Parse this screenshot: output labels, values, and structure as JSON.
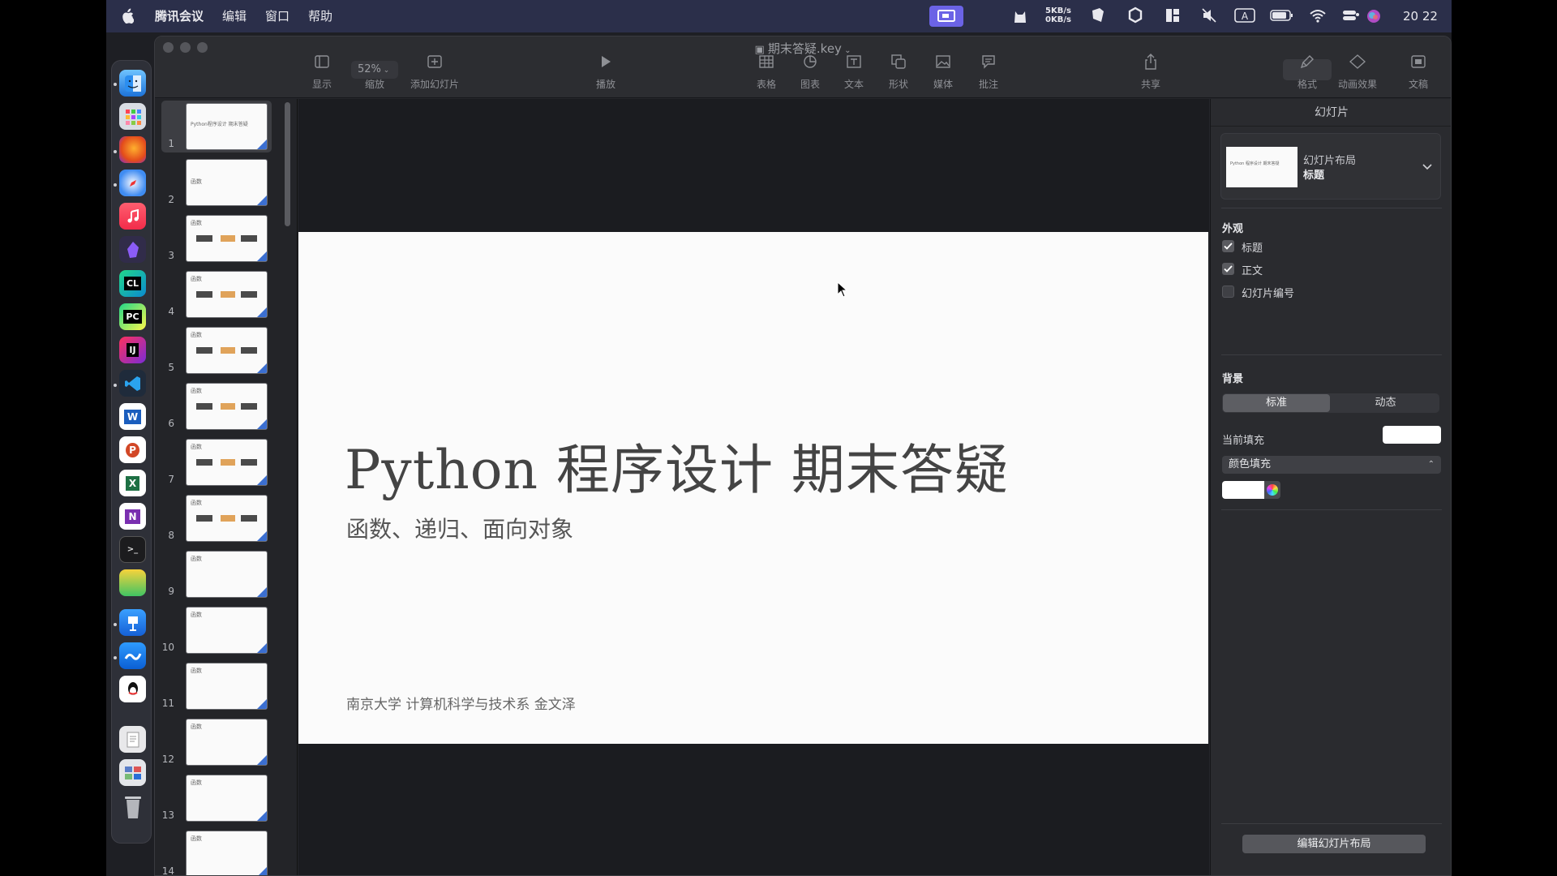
{
  "menubar": {
    "items": [
      "腾讯会议",
      "编辑",
      "窗口",
      "帮助"
    ],
    "net_up": "5KB/s",
    "net_down": "0KB/s",
    "time": "20 22"
  },
  "window": {
    "title": "期末答疑.key"
  },
  "toolbar": {
    "view": "显示",
    "zoom_value": "52%",
    "zoom": "缩放",
    "add_slide": "添加幻灯片",
    "play": "播放",
    "table": "表格",
    "chart": "图表",
    "text": "文本",
    "shape": "形状",
    "media": "媒体",
    "comment": "批注",
    "share": "共享",
    "format": "格式",
    "animate": "动画效果",
    "document": "文稿"
  },
  "navigator": {
    "slides": [
      {
        "num": "1",
        "title": "Python程序设计 期末答疑"
      },
      {
        "num": "2",
        "title": "函数"
      },
      {
        "num": "3",
        "title": "函数"
      },
      {
        "num": "4",
        "title": "函数"
      },
      {
        "num": "5",
        "title": "函数"
      },
      {
        "num": "6",
        "title": "函数"
      },
      {
        "num": "7",
        "title": "函数"
      },
      {
        "num": "8",
        "title": "函数"
      },
      {
        "num": "9",
        "title": "函数"
      },
      {
        "num": "10",
        "title": "函数"
      },
      {
        "num": "11",
        "title": "函数"
      },
      {
        "num": "12",
        "title": "函数"
      },
      {
        "num": "13",
        "title": "函数"
      },
      {
        "num": "14",
        "title": "函数"
      }
    ],
    "selected_index": 0
  },
  "slide": {
    "title": "Python 程序设计 期末答疑",
    "subtitle": "函数、递归、面向对象",
    "author": "南京大学 计算机科学与技术系 金文泽"
  },
  "inspector": {
    "header": "幻灯片",
    "layout_label": "幻灯片布局",
    "layout_value": "标题",
    "appearance_title": "外观",
    "checkbox_title": "标题",
    "checkbox_body": "正文",
    "checkbox_slide_number": "幻灯片编号",
    "background_title": "背景",
    "bg_standard": "标准",
    "bg_dynamic": "动态",
    "current_fill": "当前填充",
    "fill_type": "颜色填充",
    "edit_layout": "编辑幻灯片布局"
  },
  "colors": {
    "menubar": "#2b2f4a",
    "accent": "#3b6fd1",
    "slide_bg": "#fbfbfb"
  }
}
